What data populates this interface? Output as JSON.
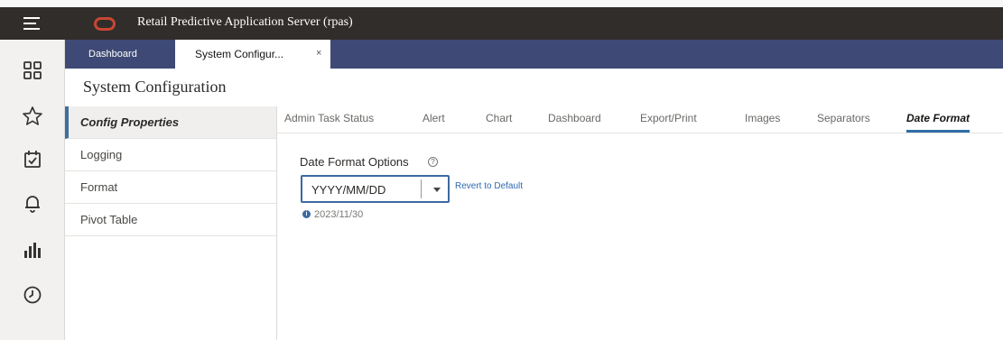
{
  "header": {
    "app_title": "Retail Predictive Application Server (rpas)",
    "logo_color": "#c74634",
    "bg_color": "#312d2a"
  },
  "rail": {
    "icons": [
      "dashboard-grid-icon",
      "favorites-star-icon",
      "tasks-calendar-icon",
      "notifications-bell-icon",
      "reports-chart-icon",
      "history-clock-icon"
    ]
  },
  "tabs": {
    "dashboard": "Dashboard",
    "system_config": "System Configur...",
    "close_glyph": "×",
    "bar_color": "#3e4a75"
  },
  "page": {
    "title": "System Configuration"
  },
  "nav": {
    "items": [
      "Config Properties",
      "Logging",
      "Format",
      "Pivot Table"
    ],
    "active_index": 0
  },
  "subtabs": {
    "items": [
      "Admin Task Status",
      "Alert",
      "Chart",
      "Dashboard",
      "Export/Print",
      "Images",
      "Separators",
      "Date Format"
    ],
    "active": "Date Format"
  },
  "date_format": {
    "label": "Date Format Options",
    "selected_value": "YYYY/MM/DD",
    "revert_label": "Revert to Default",
    "example": "2023/11/30"
  }
}
